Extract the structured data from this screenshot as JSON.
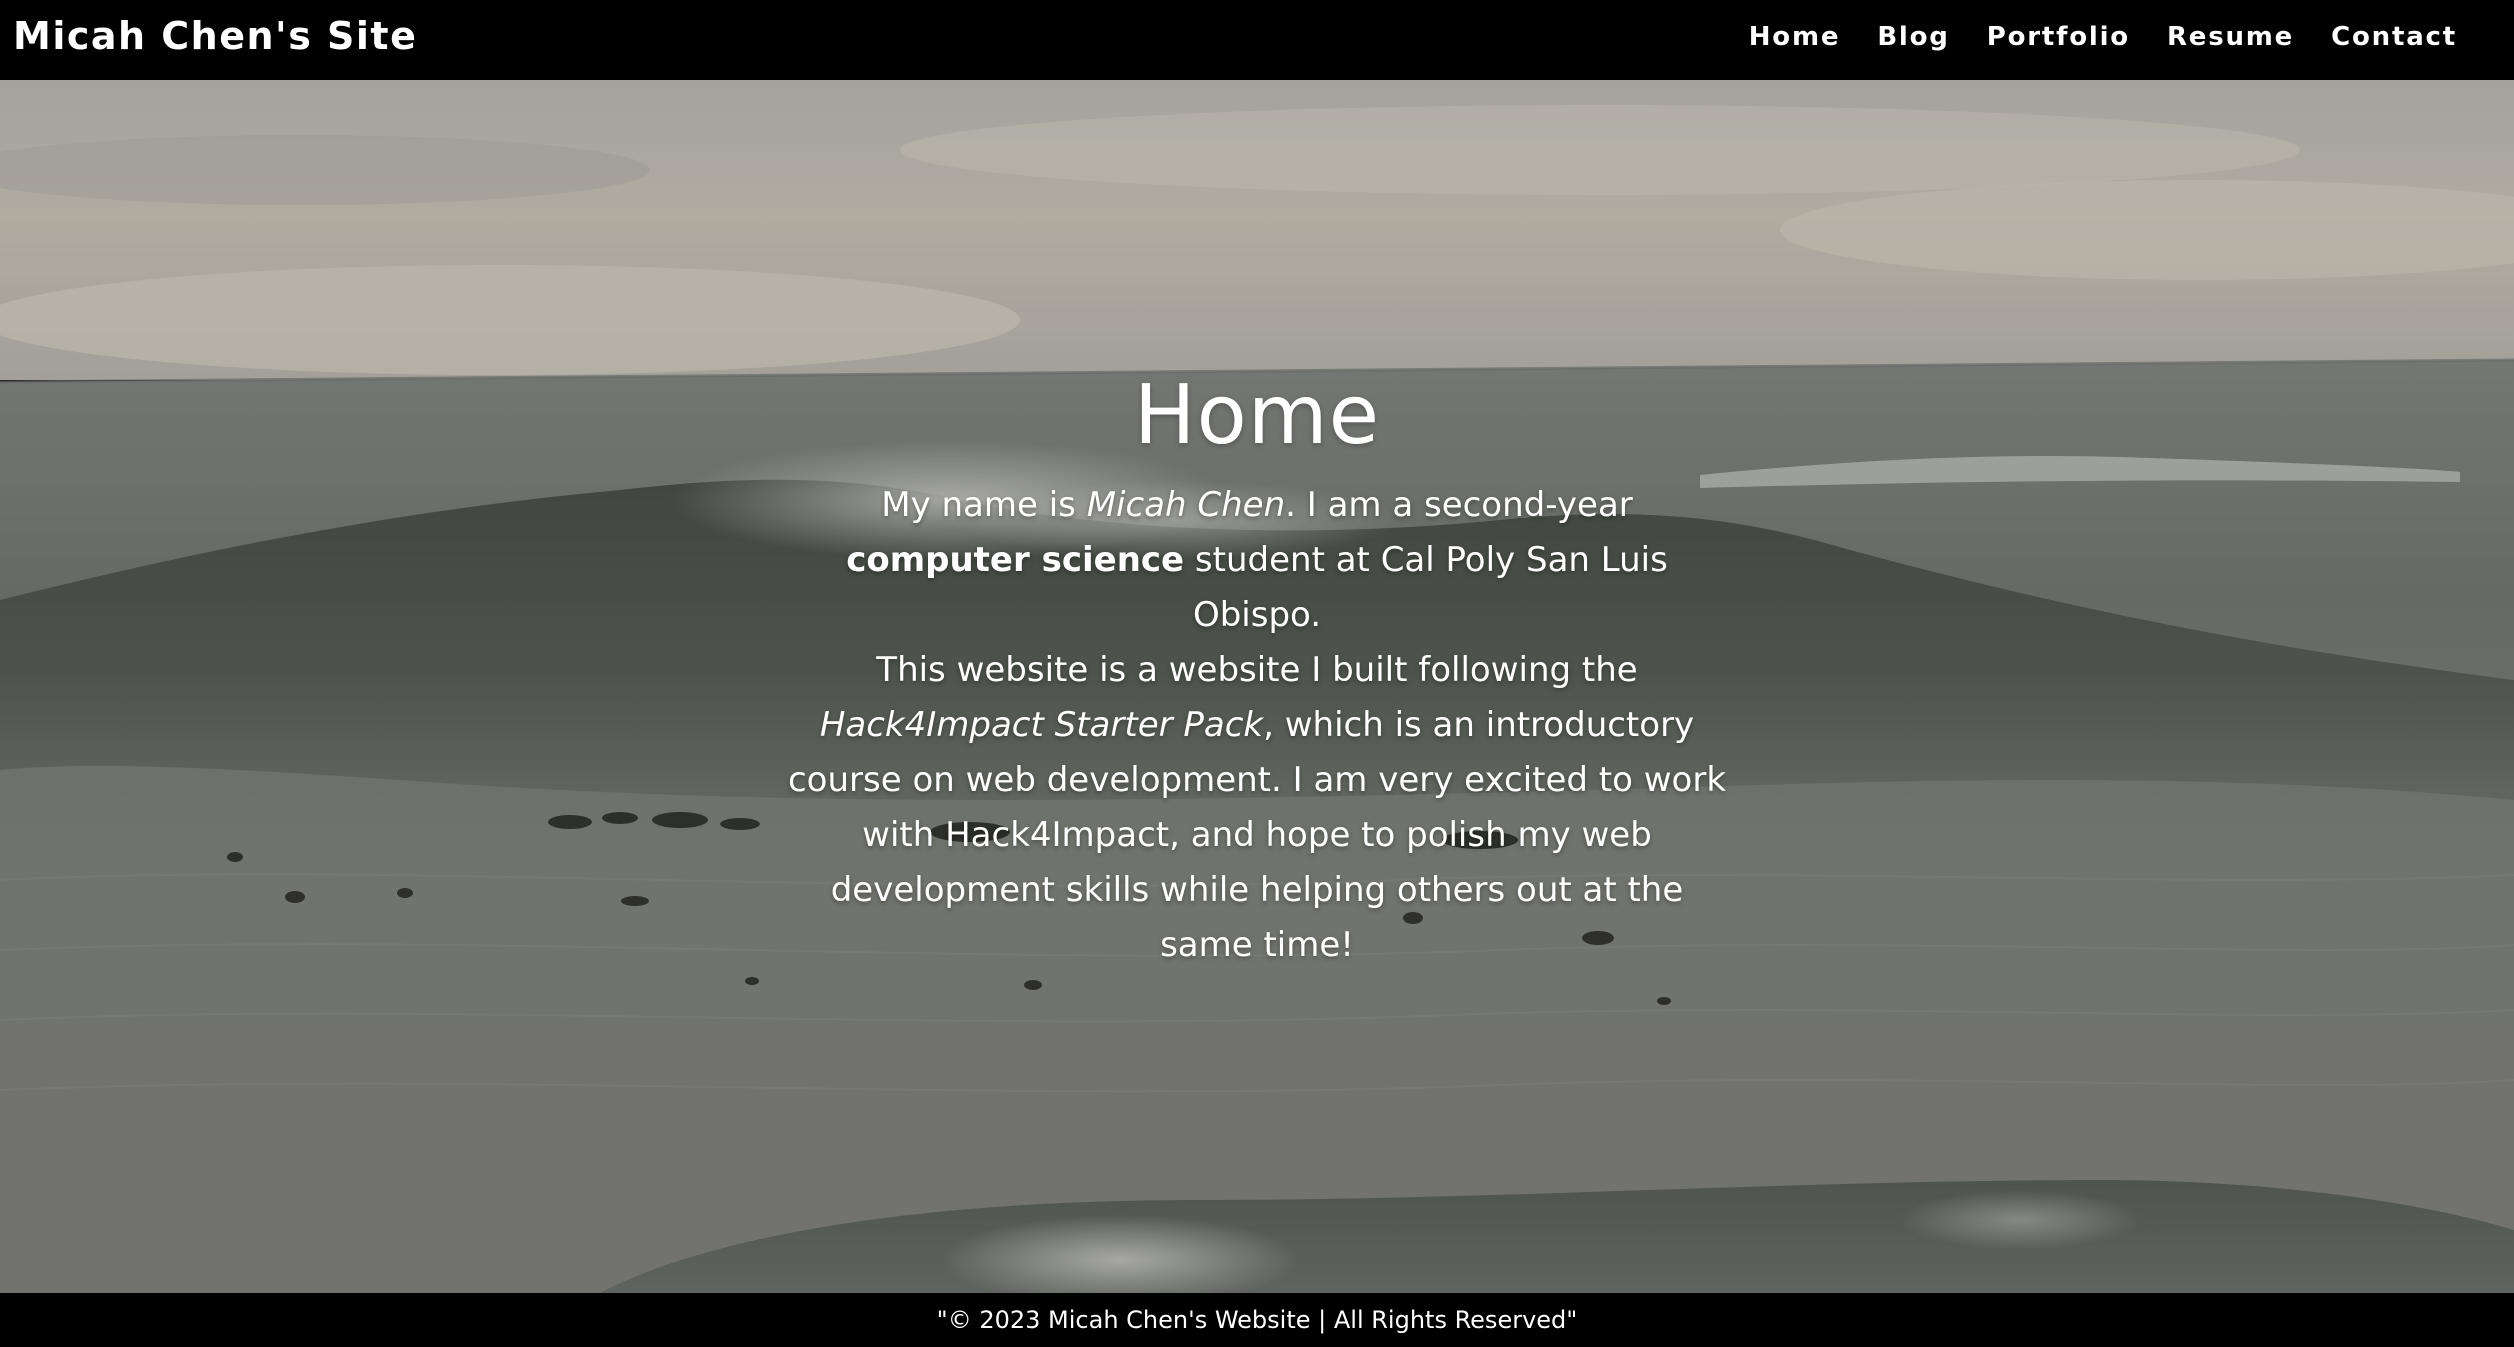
{
  "site": {
    "brand": "Micah Chen's Site"
  },
  "nav": {
    "items": [
      {
        "label": "Home"
      },
      {
        "label": "Blog"
      },
      {
        "label": "Portfolio"
      },
      {
        "label": "Resume"
      },
      {
        "label": "Contact"
      }
    ]
  },
  "hero": {
    "title": "Home",
    "intro": {
      "p1": "My name is ",
      "name": "Micah Chen",
      "p2": ". I am a second-year ",
      "major": "computer science",
      "p3": " student at Cal Poly San Luis Obispo.",
      "p4": "This website is a website I built following the ",
      "course": "Hack4Impact Starter Pack",
      "p5": ", which is an introductory course on web development. I am very excited to work with Hack4Impact, and hope to polish my web development skills while helping others out at the same time!"
    },
    "background": "ocean-wave-photo"
  },
  "footer": {
    "text": "\"© 2023 Micah Chen's Website | All Rights Reserved\""
  },
  "colors": {
    "navbar": "#000000",
    "footer": "#000000",
    "text": "#ffffff"
  }
}
